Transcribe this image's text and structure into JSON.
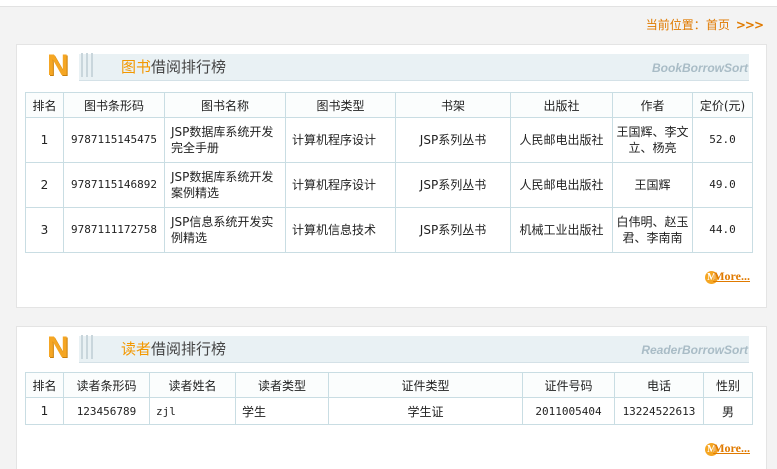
{
  "breadcrumb": {
    "label": "当前位置：",
    "home": "首页",
    "arrows": ">>>"
  },
  "books_panel": {
    "title_hl": "图书",
    "title_rest": "借阅排行榜",
    "en_title": "BookBorrowSort",
    "headers": [
      "排名",
      "图书条形码",
      "图书名称",
      "图书类型",
      "书架",
      "出版社",
      "作者",
      "定价(元)"
    ],
    "rows": [
      [
        "1",
        "9787115145475",
        "JSP数据库系统开发完全手册",
        "计算机程序设计",
        "JSP系列丛书",
        "人民邮电出版社",
        "王国辉、李文立、杨亮",
        "52.0"
      ],
      [
        "2",
        "9787115146892",
        "JSP数据库系统开发案例精选",
        "计算机程序设计",
        "JSP系列丛书",
        "人民邮电出版社",
        "王国辉",
        "49.0"
      ],
      [
        "3",
        "9787111172758",
        "JSP信息系统开发实例精选",
        "计算机信息技术",
        "JSP系列丛书",
        "机械工业出版社",
        "白伟明、赵玉君、李南南",
        "44.0"
      ]
    ],
    "more": "More..."
  },
  "readers_panel": {
    "title_hl": "读者",
    "title_rest": "借阅排行榜",
    "en_title": "ReaderBorrowSort",
    "headers": [
      "排名",
      "读者条形码",
      "读者姓名",
      "读者类型",
      "证件类型",
      "证件号码",
      "电话",
      "性别"
    ],
    "rows": [
      [
        "1",
        "123456789",
        "zjl",
        "学生",
        "学生证",
        "2011005404",
        "13224522613",
        "男"
      ]
    ],
    "more": "More..."
  },
  "icons": {
    "logo": "N-logo-icon",
    "more": "more-icon"
  },
  "colors": {
    "accent": "#f39800",
    "header_band": "#e9f1f4",
    "table_border": "#c9dde3",
    "en_title": "#a9bcc6"
  }
}
